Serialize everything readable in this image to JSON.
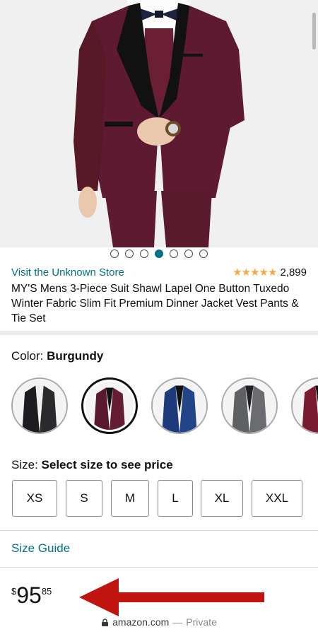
{
  "carousel": {
    "total": 7,
    "active_index": 3
  },
  "store": {
    "link_text": "Visit the Unknown Store"
  },
  "rating": {
    "stars": "★★★★★",
    "value": 4.5,
    "review_count": "2,899"
  },
  "product": {
    "title": "MY'S Mens 3-Piece Suit Shawl Lapel One Button Tuxedo Winter Fabric Slim Fit Premium Dinner Jacket Vest Pants & Tie Set"
  },
  "color": {
    "label": "Color:",
    "selected": "Burgundy",
    "options": [
      {
        "name": "black",
        "hex": "#1d1d1f"
      },
      {
        "name": "burgundy",
        "hex": "#5a1a2e",
        "selected": true
      },
      {
        "name": "navy",
        "hex": "#1f3a7a"
      },
      {
        "name": "gray",
        "hex": "#5f6063"
      },
      {
        "name": "wine",
        "hex": "#7a1a30"
      }
    ]
  },
  "size": {
    "label": "Size:",
    "prompt": "Select size to see price",
    "options": [
      "XS",
      "S",
      "M",
      "L",
      "XL",
      "XXL"
    ]
  },
  "size_guide": {
    "label": "Size Guide"
  },
  "price": {
    "symbol": "$",
    "whole": "95",
    "fraction": "85"
  },
  "browser": {
    "domain": "amazon.com",
    "separator": "—",
    "mode": "Private"
  },
  "colors": {
    "link": "#007185",
    "star": "#f3a847",
    "arrow": "#c0140f"
  }
}
